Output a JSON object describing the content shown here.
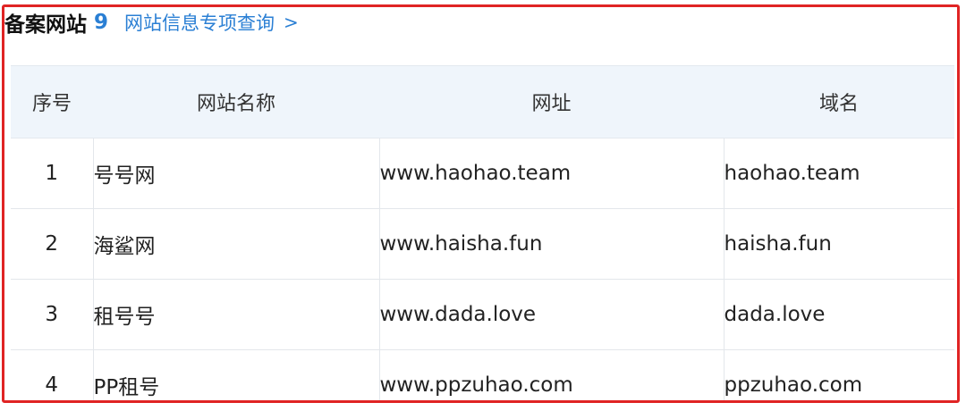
{
  "header": {
    "title": "备案网站",
    "count": "9",
    "link_label": "网站信息专项查询",
    "link_chevron": ">"
  },
  "table": {
    "columns": [
      "序号",
      "网站名称",
      "网址",
      "域名"
    ],
    "rows": [
      {
        "no": "1",
        "name": "号号网",
        "url": "www.haohao.team",
        "domain": "haohao.team"
      },
      {
        "no": "2",
        "name": "海鲨网",
        "url": "www.haisha.fun",
        "domain": "haisha.fun"
      },
      {
        "no": "3",
        "name": "租号号",
        "url": "www.dada.love",
        "domain": "dada.love"
      },
      {
        "no": "4",
        "name": "PP租号",
        "url": "www.ppzuhao.com",
        "domain": "ppzuhao.com"
      }
    ]
  },
  "colors": {
    "highlight_border": "#e02424",
    "link": "#2a82d8",
    "header_bg": "#eff5fb"
  }
}
